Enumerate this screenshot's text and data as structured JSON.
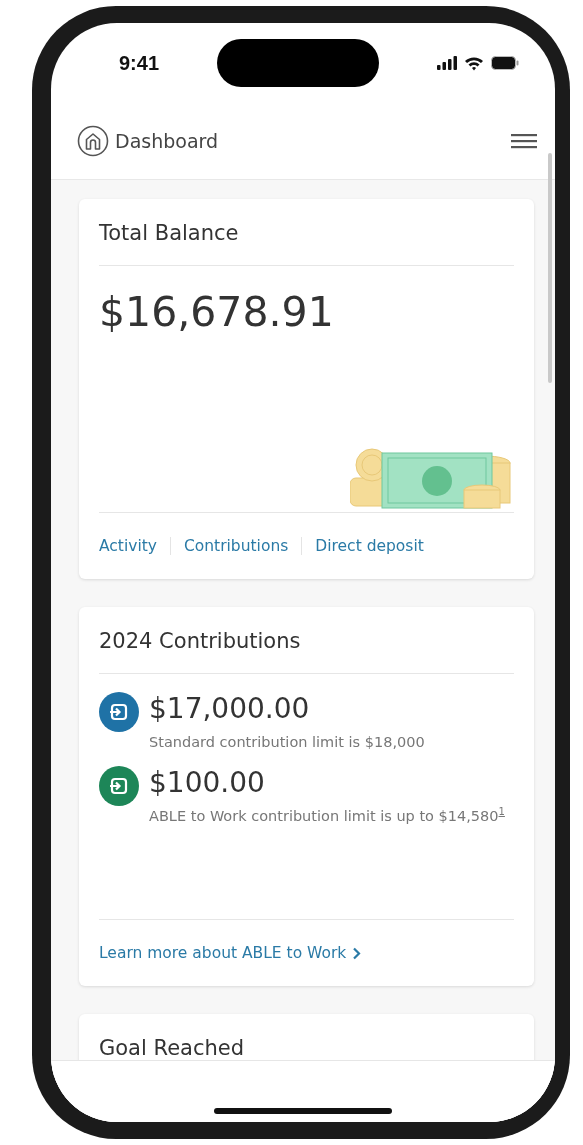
{
  "status_bar": {
    "time": "9:41"
  },
  "header": {
    "title": "Dashboard"
  },
  "balance_card": {
    "title": "Total Balance",
    "amount": "$16,678.91",
    "links": [
      "Activity",
      "Contributions",
      "Direct deposit"
    ]
  },
  "contributions_card": {
    "title": "2024 Contributions",
    "items": [
      {
        "amount": "$17,000.00",
        "note": "Standard contribution limit is $18,000",
        "color": "#1f72a6"
      },
      {
        "amount": "$100.00",
        "note": "ABLE to Work contribution limit is up to $14,580$^{1}$",
        "color": "#1d8658"
      }
    ],
    "link": "Learn more about ABLE to Work"
  },
  "goal_card": {
    "title": "Goal Reached"
  }
}
